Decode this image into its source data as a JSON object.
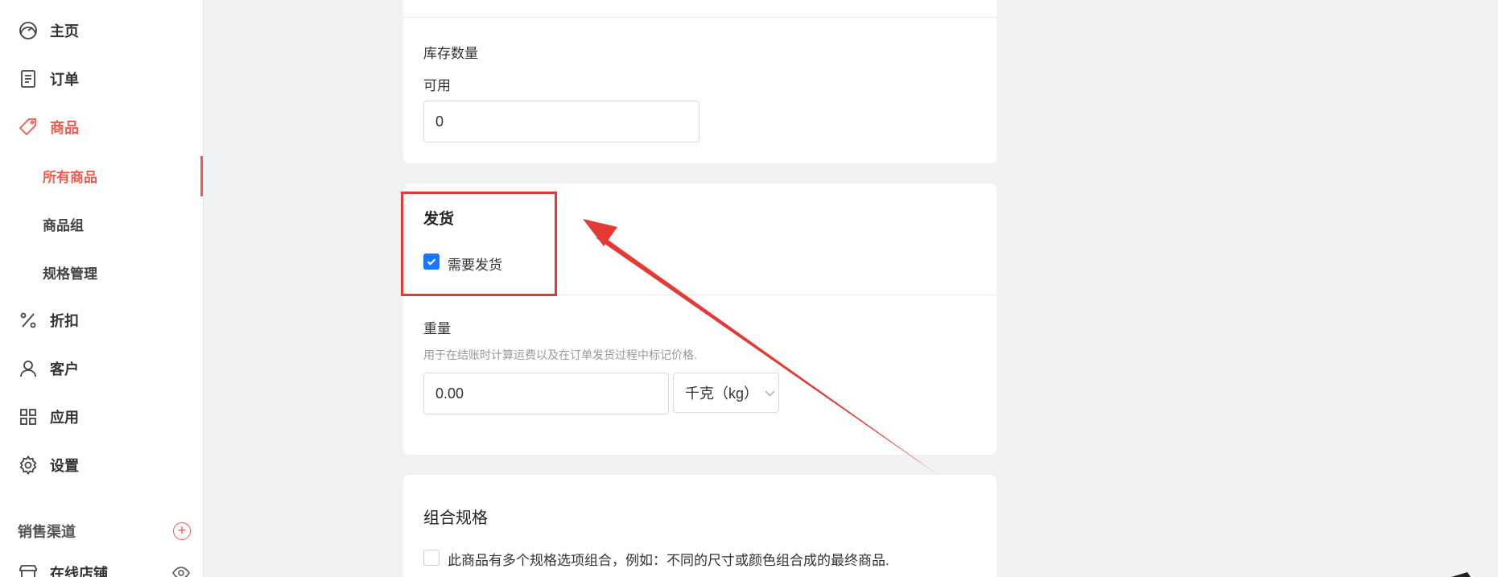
{
  "sidebar": {
    "items": [
      {
        "label": "主页",
        "icon": "dashboard-icon"
      },
      {
        "label": "订单",
        "icon": "order-icon"
      },
      {
        "label": "商品",
        "icon": "tag-icon"
      },
      {
        "label": "折扣",
        "icon": "percent-icon"
      },
      {
        "label": "客户",
        "icon": "user-icon"
      },
      {
        "label": "应用",
        "icon": "apps-icon"
      },
      {
        "label": "设置",
        "icon": "gear-icon"
      }
    ],
    "product_sub": [
      {
        "label": "所有商品"
      },
      {
        "label": "商品组"
      },
      {
        "label": "规格管理"
      }
    ],
    "channels_title": "销售渠道",
    "online_store": "在线店铺",
    "accent_color": "#ee5a4f"
  },
  "inventory": {
    "title": "库存数量",
    "available_label": "可用",
    "available_value": "0"
  },
  "shipping": {
    "title": "发货",
    "requires_shipping_label": "需要发货",
    "requires_shipping_checked": true,
    "weight_title": "重量",
    "weight_hint": "用于在结账时计算运费以及在订单发货过程中标记价格.",
    "weight_value": "0.00",
    "weight_unit": "千克（kg）"
  },
  "variants": {
    "title": "组合规格",
    "option_label": "此商品有多个规格选项组合，例如：不同的尺寸或颜色组合成的最终商品.",
    "option_checked": false
  },
  "annotation": {
    "color": "#e53935"
  }
}
